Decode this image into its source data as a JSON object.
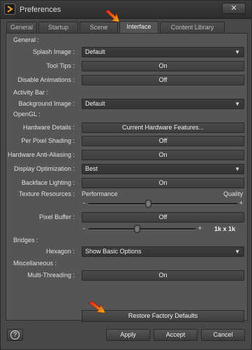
{
  "window": {
    "title": "Preferences",
    "close_label": "✕"
  },
  "tabs": [
    {
      "label": "General"
    },
    {
      "label": "Startup"
    },
    {
      "label": "Scene"
    },
    {
      "label": "Interface"
    },
    {
      "label": "Content Library"
    }
  ],
  "sections": {
    "general": "General :",
    "activity_bar": "Activity Bar :",
    "opengl": "OpenGL :",
    "bridges": "Bridges :",
    "misc": "Miscellaneous :"
  },
  "general": {
    "splash_label": "Splash Image :",
    "splash_value": "Default",
    "tooltips_label": "Tool Tips :",
    "tooltips_value": "On",
    "disable_anim_label": "Disable Animations :",
    "disable_anim_value": "Off"
  },
  "activity_bar": {
    "bg_label": "Background Image :",
    "bg_value": "Default"
  },
  "opengl": {
    "hw_details_label": "Hardware Details :",
    "hw_details_value": "Current Hardware Features...",
    "ppshading_label": "Per Pixel Shading :",
    "ppshading_value": "Off",
    "hw_aa_label": "Hardware Anti-Aliasing :",
    "hw_aa_value": "On",
    "disp_opt_label": "Display Optimization :",
    "disp_opt_value": "Best",
    "backface_label": "Backface Lighting :",
    "backface_value": "On",
    "texres_label": "Texture Resources :",
    "texres_left": "Performance",
    "texres_right": "Quality",
    "texres_minus": "-",
    "texres_plus": "+",
    "texres_level": 0.4,
    "pixbuf_label": "Pixel Buffer :",
    "pixbuf_value": "Off",
    "pixbuf_minus": "-",
    "pixbuf_plus": "+",
    "pixbuf_size": "1k x 1k",
    "pixbuf_level": 0.45
  },
  "bridges": {
    "hexagon_label": "Hexagon :",
    "hexagon_value": "Show Basic Options"
  },
  "misc": {
    "mt_label": "Multi-Threading :",
    "mt_value": "On"
  },
  "restore_label": "Restore Factory Defaults",
  "footer": {
    "help_label": "?",
    "apply": "Apply",
    "accept": "Accept",
    "cancel": "Cancel"
  },
  "icons": {
    "dropdown": "chevron-down-icon",
    "pointer": "arrow-pointer-icon"
  }
}
